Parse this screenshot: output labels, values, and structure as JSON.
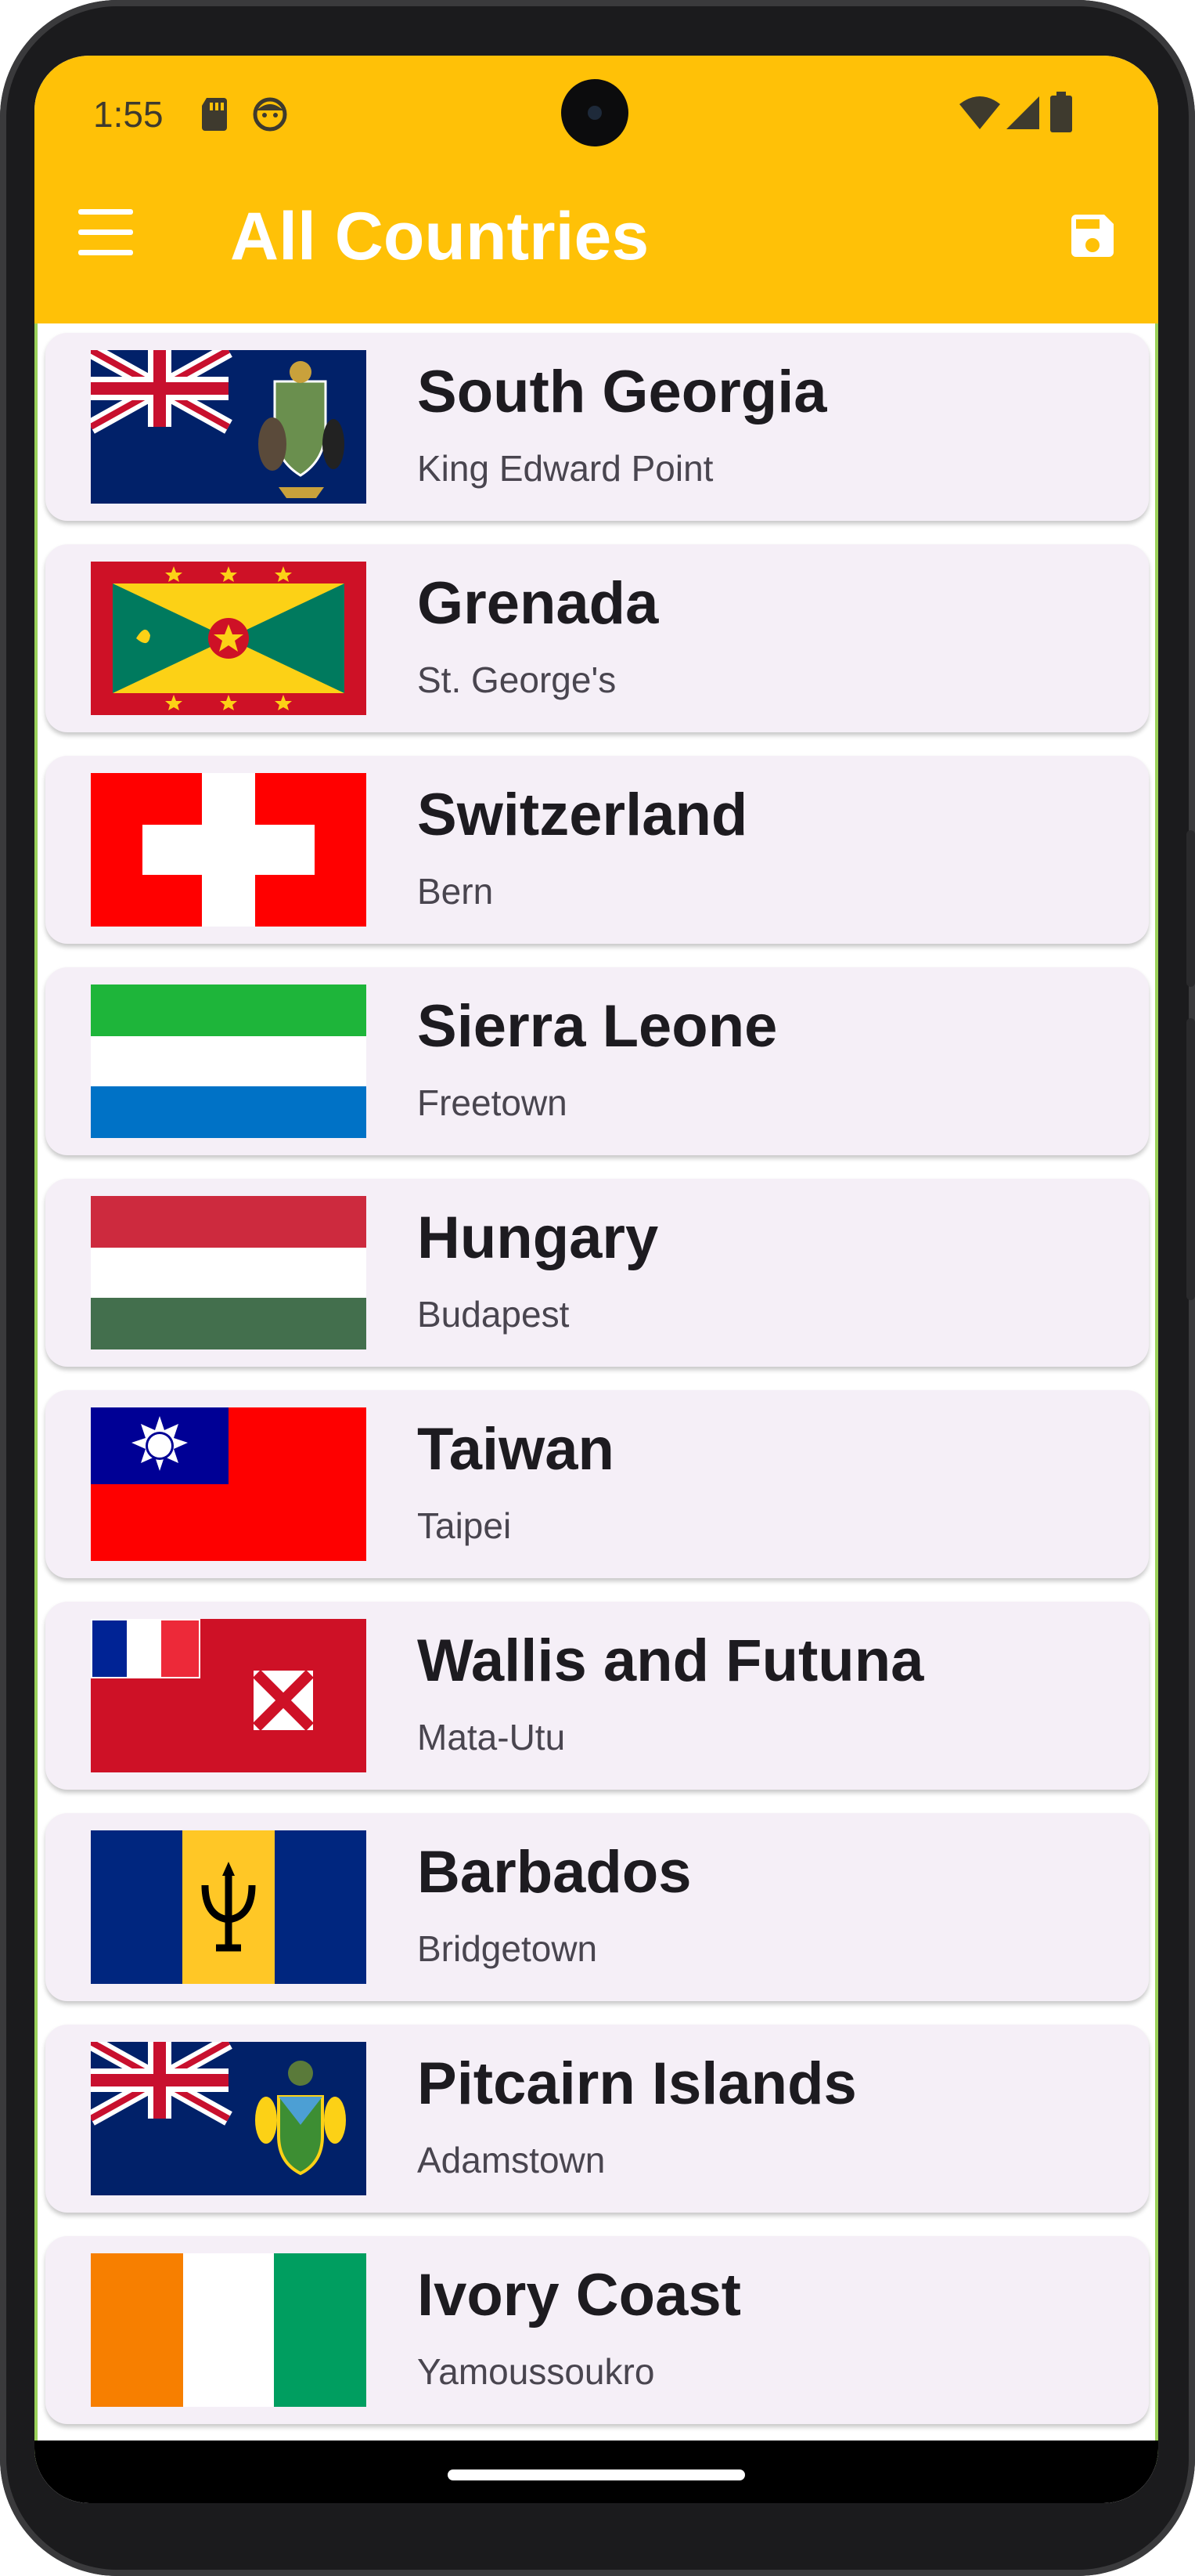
{
  "status_bar": {
    "time": "1:55",
    "icons": [
      "sd-card-icon",
      "face-icon",
      "wifi-icon",
      "cellular-signal-icon",
      "battery-icon"
    ]
  },
  "toolbar": {
    "title": "All Countries",
    "menu_icon": "hamburger-menu-icon",
    "save_icon": "save-icon",
    "color": "#FFC107"
  },
  "countries": [
    {
      "name": "South Georgia",
      "capital": "King Edward Point",
      "flag": "south-georgia-flag"
    },
    {
      "name": "Grenada",
      "capital": "St. George's",
      "flag": "grenada-flag"
    },
    {
      "name": "Switzerland",
      "capital": "Bern",
      "flag": "switzerland-flag"
    },
    {
      "name": "Sierra Leone",
      "capital": "Freetown",
      "flag": "sierra-leone-flag"
    },
    {
      "name": "Hungary",
      "capital": "Budapest",
      "flag": "hungary-flag"
    },
    {
      "name": "Taiwan",
      "capital": "Taipei",
      "flag": "taiwan-flag"
    },
    {
      "name": "Wallis and Futuna",
      "capital": "Mata-Utu",
      "flag": "wallis-and-futuna-flag"
    },
    {
      "name": "Barbados",
      "capital": "Bridgetown",
      "flag": "barbados-flag"
    },
    {
      "name": "Pitcairn Islands",
      "capital": "Adamstown",
      "flag": "pitcairn-islands-flag"
    },
    {
      "name": "Ivory Coast",
      "capital": "Yamoussoukro",
      "flag": "ivory-coast-flag"
    }
  ]
}
